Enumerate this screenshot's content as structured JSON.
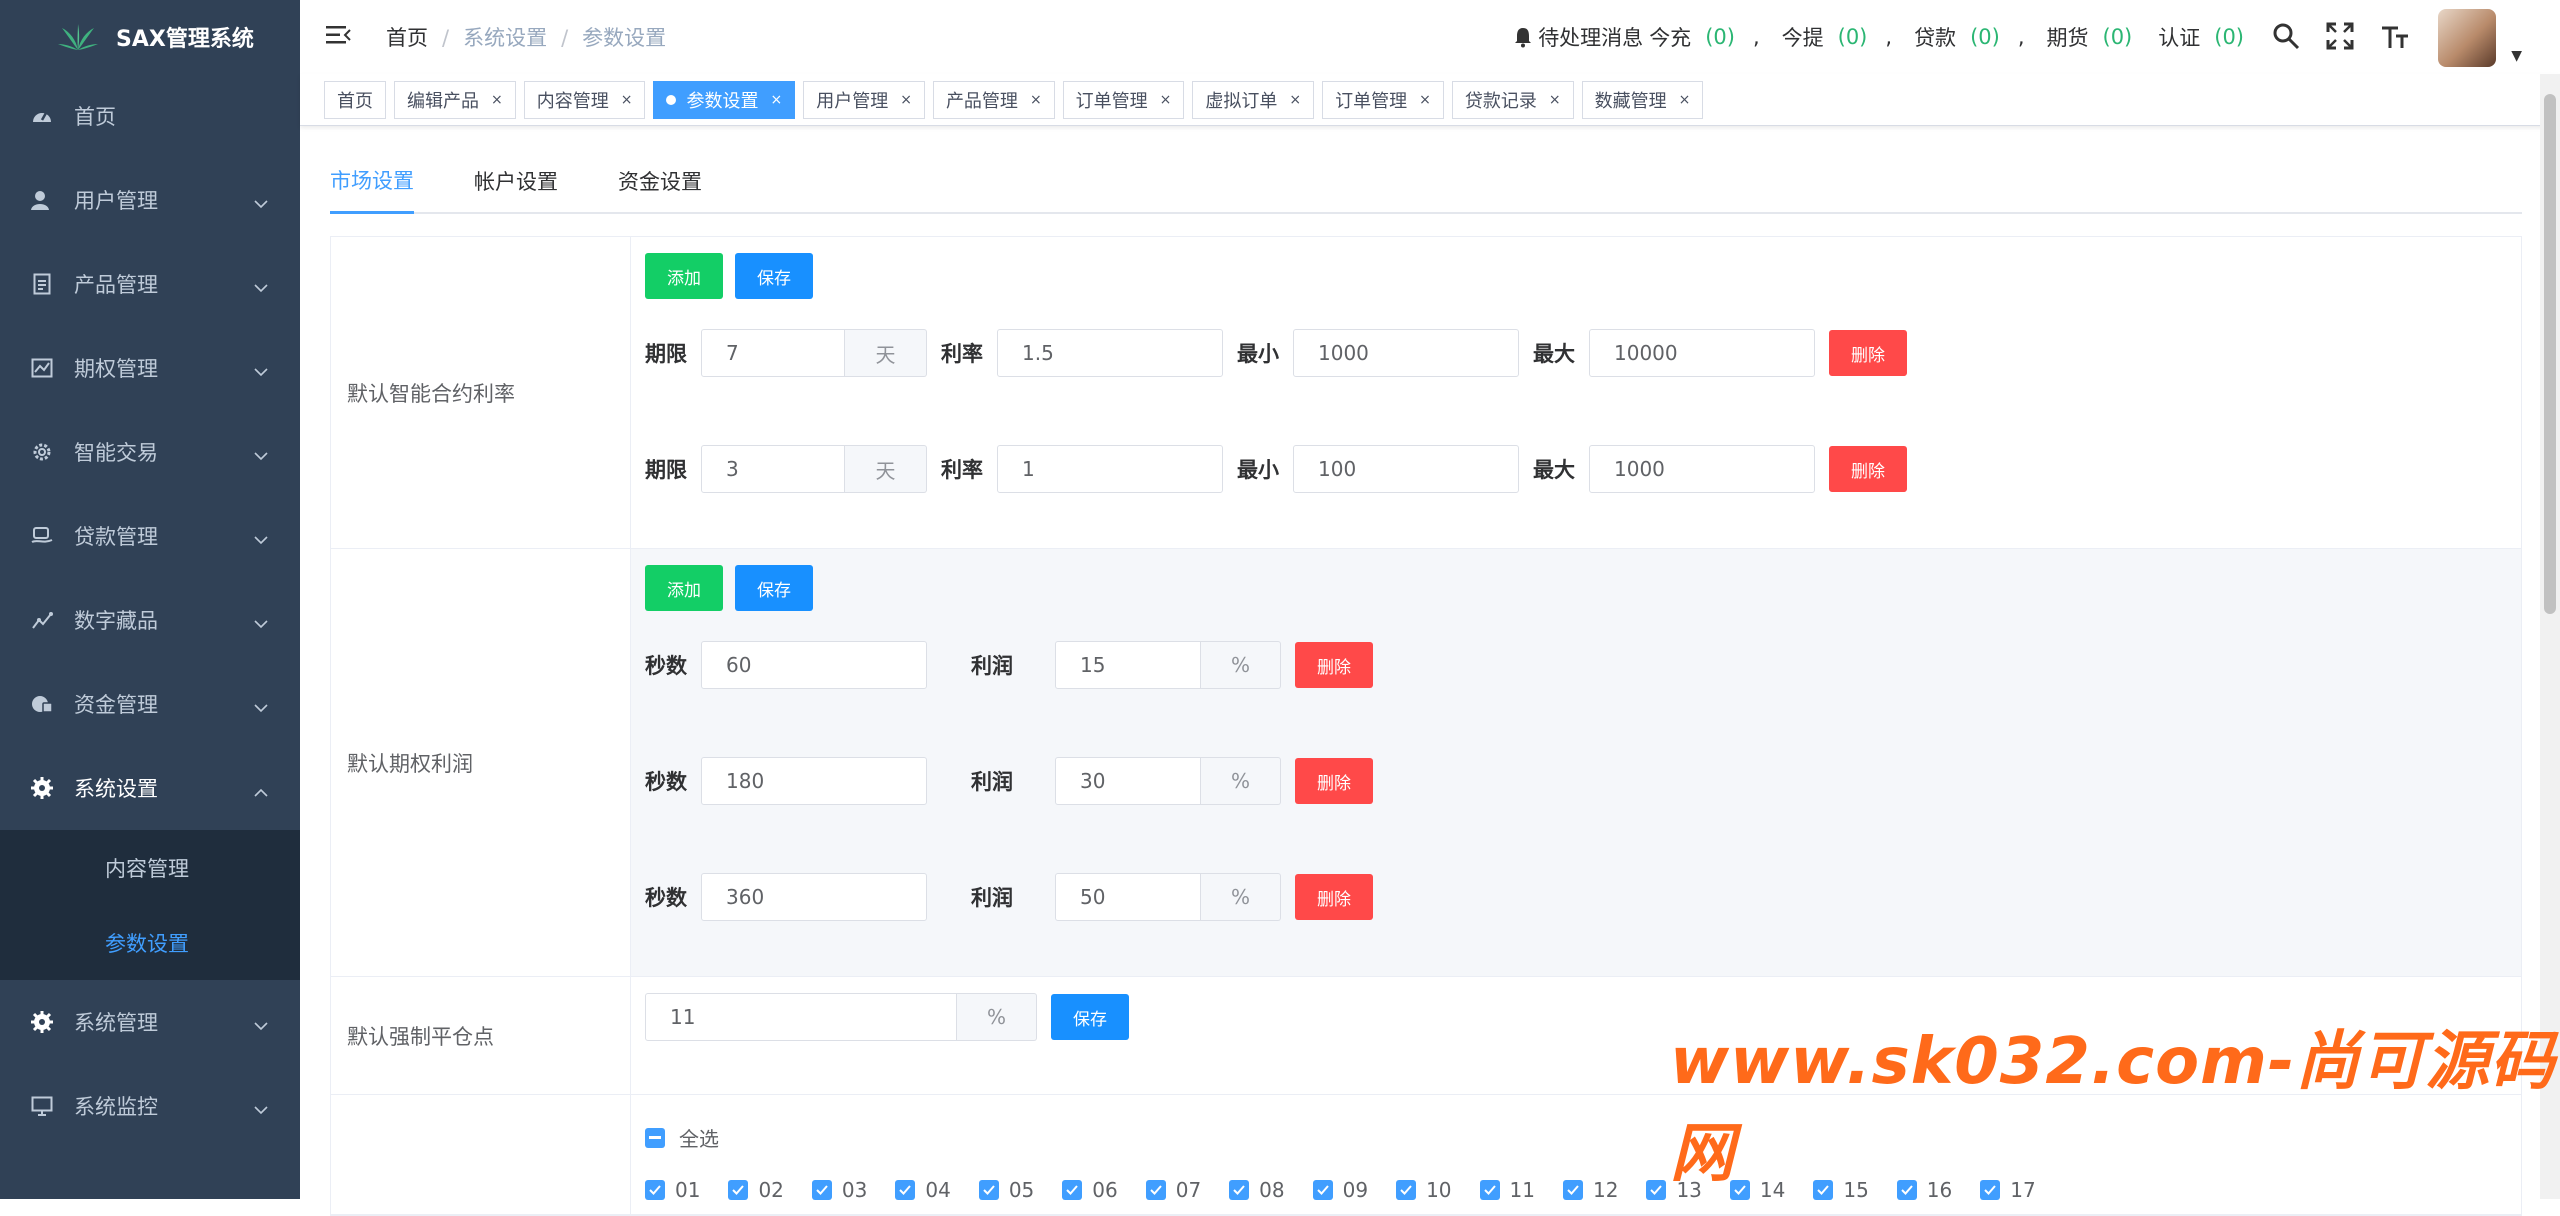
{
  "app": {
    "title": "SAX管理系统"
  },
  "sidebar": {
    "items": [
      {
        "label": "首页",
        "icon": "dashboard-icon"
      },
      {
        "label": "用户管理",
        "icon": "user-icon"
      },
      {
        "label": "产品管理",
        "icon": "document-icon"
      },
      {
        "label": "期权管理",
        "icon": "chart-icon"
      },
      {
        "label": "智能交易",
        "icon": "gear-icon"
      },
      {
        "label": "贷款管理",
        "icon": "money-icon"
      },
      {
        "label": "数字藏品",
        "icon": "trend-icon"
      },
      {
        "label": "资金管理",
        "icon": "wallet-icon"
      },
      {
        "label": "系统设置",
        "icon": "settings-icon"
      }
    ],
    "subitems": [
      {
        "label": "内容管理"
      },
      {
        "label": "参数设置"
      }
    ],
    "items_after": [
      {
        "label": "系统管理",
        "icon": "settings-icon"
      },
      {
        "label": "系统监控",
        "icon": "monitor-icon"
      }
    ]
  },
  "header": {
    "breadcrumb": [
      "首页",
      "系统设置",
      "参数设置"
    ],
    "notice_prefix": "待处理消息",
    "counters": [
      {
        "label": "今充",
        "value": "(0)"
      },
      {
        "label": "今提",
        "value": "(0)"
      },
      {
        "label": "贷款",
        "value": "(0)"
      },
      {
        "label": "期货",
        "value": "(0)"
      },
      {
        "label": "认证",
        "value": "(0)"
      }
    ],
    "comma": ","
  },
  "tags": [
    {
      "label": "首页",
      "closable": false
    },
    {
      "label": "编辑产品",
      "closable": true
    },
    {
      "label": "内容管理",
      "closable": true
    },
    {
      "label": "参数设置",
      "closable": true,
      "active": true
    },
    {
      "label": "用户管理",
      "closable": true
    },
    {
      "label": "产品管理",
      "closable": true
    },
    {
      "label": "订单管理",
      "closable": true
    },
    {
      "label": "虚拟订单",
      "closable": true
    },
    {
      "label": "订单管理",
      "closable": true
    },
    {
      "label": "贷款记录",
      "closable": true
    },
    {
      "label": "数藏管理",
      "closable": true
    }
  ],
  "tabs": [
    "市场设置",
    "帐户设置",
    "资金设置"
  ],
  "buttons": {
    "add": "添加",
    "save": "保存",
    "delete": "删除"
  },
  "section1": {
    "label": "默认智能合约利率",
    "term_label": "期限",
    "unit_day": "天",
    "rate_label": "利率",
    "min_label": "最小",
    "max_label": "最大",
    "rows": [
      {
        "term": "7",
        "rate": "1.5",
        "min": "1000",
        "max": "10000"
      },
      {
        "term": "3",
        "rate": "1",
        "min": "100",
        "max": "1000"
      }
    ]
  },
  "section2": {
    "label": "默认期权利润",
    "sec_label": "秒数",
    "profit_label": "利润",
    "unit_pct": "%",
    "rows": [
      {
        "sec": "60",
        "profit": "15"
      },
      {
        "sec": "180",
        "profit": "30"
      },
      {
        "sec": "360",
        "profit": "50"
      }
    ]
  },
  "section3": {
    "label": "默认强制平仓点",
    "value": "11",
    "unit_pct": "%"
  },
  "section4": {
    "select_all": "全选",
    "options": [
      "01",
      "02",
      "03",
      "04",
      "05",
      "06",
      "07",
      "08",
      "09",
      "10",
      "11",
      "12",
      "13",
      "14",
      "15",
      "16",
      "17"
    ]
  },
  "watermark": "www.sk032.com-尚可源码网"
}
